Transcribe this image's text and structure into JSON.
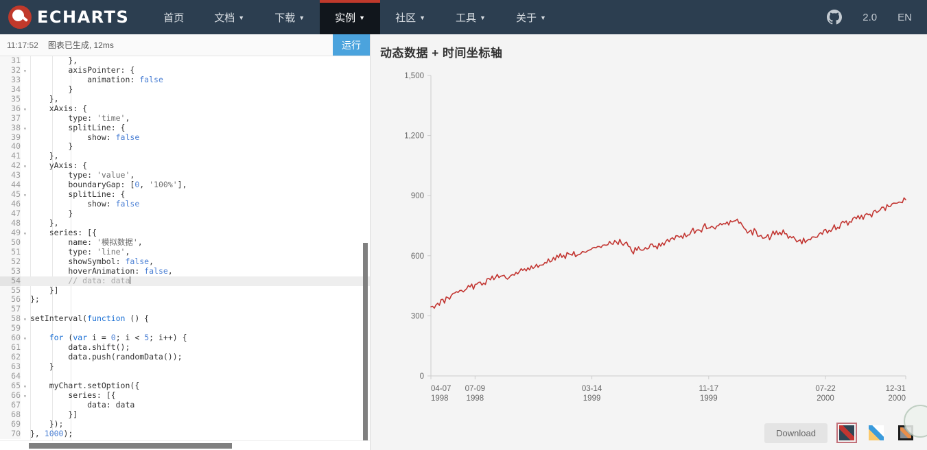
{
  "navbar": {
    "brand": "ECHARTS",
    "logo_icon": "echarts-logo-icon",
    "items": [
      {
        "label": "首页",
        "has_caret": false,
        "active": false
      },
      {
        "label": "文档",
        "has_caret": true,
        "active": false
      },
      {
        "label": "下载",
        "has_caret": true,
        "active": false
      },
      {
        "label": "实例",
        "has_caret": true,
        "active": true
      },
      {
        "label": "社区",
        "has_caret": true,
        "active": false
      },
      {
        "label": "工具",
        "has_caret": true,
        "active": false
      },
      {
        "label": "关于",
        "has_caret": true,
        "active": false
      }
    ],
    "github_icon": "github-icon",
    "version": "2.0",
    "language": "EN",
    "caret_glyph": "▼",
    "bg_color": "#2c3e50",
    "active_bg_color": "#11161c",
    "accent_color": "#c0392b"
  },
  "editor": {
    "status_time": "11:17:52",
    "status_message": "图表已生成, 12ms",
    "run_label": "运行",
    "run_color": "#4ba3dd",
    "active_line": 54,
    "lines": [
      {
        "n": 31,
        "fold": false,
        "tokens": [
          {
            "t": "        },",
            "c": "src"
          }
        ]
      },
      {
        "n": 32,
        "fold": true,
        "tokens": [
          {
            "t": "        axisPointer: {",
            "c": "src"
          }
        ]
      },
      {
        "n": 33,
        "fold": false,
        "tokens": [
          {
            "t": "            animation: ",
            "c": "src"
          },
          {
            "t": "false",
            "c": "bool"
          }
        ]
      },
      {
        "n": 34,
        "fold": false,
        "tokens": [
          {
            "t": "        }",
            "c": "src"
          }
        ]
      },
      {
        "n": 35,
        "fold": false,
        "tokens": [
          {
            "t": "    },",
            "c": "src"
          }
        ]
      },
      {
        "n": 36,
        "fold": true,
        "tokens": [
          {
            "t": "    xAxis: {",
            "c": "src"
          }
        ]
      },
      {
        "n": 37,
        "fold": false,
        "tokens": [
          {
            "t": "        type: ",
            "c": "src"
          },
          {
            "t": "'time'",
            "c": "str"
          },
          {
            "t": ",",
            "c": "src"
          }
        ]
      },
      {
        "n": 38,
        "fold": true,
        "tokens": [
          {
            "t": "        splitLine: {",
            "c": "src"
          }
        ]
      },
      {
        "n": 39,
        "fold": false,
        "tokens": [
          {
            "t": "            show: ",
            "c": "src"
          },
          {
            "t": "false",
            "c": "bool"
          }
        ]
      },
      {
        "n": 40,
        "fold": false,
        "tokens": [
          {
            "t": "        }",
            "c": "src"
          }
        ]
      },
      {
        "n": 41,
        "fold": false,
        "tokens": [
          {
            "t": "    },",
            "c": "src"
          }
        ]
      },
      {
        "n": 42,
        "fold": true,
        "tokens": [
          {
            "t": "    yAxis: {",
            "c": "src"
          }
        ]
      },
      {
        "n": 43,
        "fold": false,
        "tokens": [
          {
            "t": "        type: ",
            "c": "src"
          },
          {
            "t": "'value'",
            "c": "str"
          },
          {
            "t": ",",
            "c": "src"
          }
        ]
      },
      {
        "n": 44,
        "fold": false,
        "tokens": [
          {
            "t": "        boundaryGap: [",
            "c": "src"
          },
          {
            "t": "0",
            "c": "num"
          },
          {
            "t": ", ",
            "c": "src"
          },
          {
            "t": "'100%'",
            "c": "str"
          },
          {
            "t": "],",
            "c": "src"
          }
        ]
      },
      {
        "n": 45,
        "fold": true,
        "tokens": [
          {
            "t": "        splitLine: {",
            "c": "src"
          }
        ]
      },
      {
        "n": 46,
        "fold": false,
        "tokens": [
          {
            "t": "            show: ",
            "c": "src"
          },
          {
            "t": "false",
            "c": "bool"
          }
        ]
      },
      {
        "n": 47,
        "fold": false,
        "tokens": [
          {
            "t": "        }",
            "c": "src"
          }
        ]
      },
      {
        "n": 48,
        "fold": false,
        "tokens": [
          {
            "t": "    },",
            "c": "src"
          }
        ]
      },
      {
        "n": 49,
        "fold": true,
        "tokens": [
          {
            "t": "    series: [{",
            "c": "src"
          }
        ]
      },
      {
        "n": 50,
        "fold": false,
        "tokens": [
          {
            "t": "        name: ",
            "c": "src"
          },
          {
            "t": "'模拟数据'",
            "c": "str"
          },
          {
            "t": ",",
            "c": "src"
          }
        ]
      },
      {
        "n": 51,
        "fold": false,
        "tokens": [
          {
            "t": "        type: ",
            "c": "src"
          },
          {
            "t": "'line'",
            "c": "str"
          },
          {
            "t": ",",
            "c": "src"
          }
        ]
      },
      {
        "n": 52,
        "fold": false,
        "tokens": [
          {
            "t": "        showSymbol: ",
            "c": "src"
          },
          {
            "t": "false",
            "c": "bool"
          },
          {
            "t": ",",
            "c": "src"
          }
        ]
      },
      {
        "n": 53,
        "fold": false,
        "tokens": [
          {
            "t": "        hoverAnimation: ",
            "c": "src"
          },
          {
            "t": "false",
            "c": "bool"
          },
          {
            "t": ",",
            "c": "src"
          }
        ]
      },
      {
        "n": 54,
        "fold": false,
        "tokens": [
          {
            "t": "        // data: data",
            "c": "cmt"
          }
        ],
        "caret": true
      },
      {
        "n": 55,
        "fold": false,
        "tokens": [
          {
            "t": "    }]",
            "c": "src"
          }
        ]
      },
      {
        "n": 56,
        "fold": false,
        "tokens": [
          {
            "t": "};",
            "c": "src"
          }
        ]
      },
      {
        "n": 57,
        "fold": false,
        "tokens": [
          {
            "t": "",
            "c": "src"
          }
        ]
      },
      {
        "n": 58,
        "fold": true,
        "tokens": [
          {
            "t": "setInterval(",
            "c": "src"
          },
          {
            "t": "function",
            "c": "kw"
          },
          {
            "t": " () {",
            "c": "src"
          }
        ]
      },
      {
        "n": 59,
        "fold": false,
        "tokens": [
          {
            "t": "",
            "c": "src"
          }
        ]
      },
      {
        "n": 60,
        "fold": true,
        "tokens": [
          {
            "t": "    ",
            "c": "src"
          },
          {
            "t": "for",
            "c": "kw"
          },
          {
            "t": " (",
            "c": "src"
          },
          {
            "t": "var",
            "c": "kw"
          },
          {
            "t": " i = ",
            "c": "src"
          },
          {
            "t": "0",
            "c": "num"
          },
          {
            "t": "; i < ",
            "c": "src"
          },
          {
            "t": "5",
            "c": "num"
          },
          {
            "t": "; i++) {",
            "c": "src"
          }
        ]
      },
      {
        "n": 61,
        "fold": false,
        "tokens": [
          {
            "t": "        data.shift();",
            "c": "src"
          }
        ]
      },
      {
        "n": 62,
        "fold": false,
        "tokens": [
          {
            "t": "        data.push(randomData());",
            "c": "src"
          }
        ]
      },
      {
        "n": 63,
        "fold": false,
        "tokens": [
          {
            "t": "    }",
            "c": "src"
          }
        ]
      },
      {
        "n": 64,
        "fold": false,
        "tokens": [
          {
            "t": "",
            "c": "src"
          }
        ]
      },
      {
        "n": 65,
        "fold": true,
        "tokens": [
          {
            "t": "    myChart.setOption({",
            "c": "src"
          }
        ]
      },
      {
        "n": 66,
        "fold": true,
        "tokens": [
          {
            "t": "        series: [{",
            "c": "src"
          }
        ]
      },
      {
        "n": 67,
        "fold": false,
        "tokens": [
          {
            "t": "            data: data",
            "c": "src"
          }
        ]
      },
      {
        "n": 68,
        "fold": false,
        "tokens": [
          {
            "t": "        }]",
            "c": "src"
          }
        ]
      },
      {
        "n": 69,
        "fold": false,
        "tokens": [
          {
            "t": "    });",
            "c": "src"
          }
        ]
      },
      {
        "n": 70,
        "fold": false,
        "tokens": [
          {
            "t": "}, ",
            "c": "src"
          },
          {
            "t": "1000",
            "c": "num"
          },
          {
            "t": ");",
            "c": "src"
          }
        ]
      }
    ],
    "fold_glyph": "▾"
  },
  "chart_panel": {
    "title": "动态数据 + 时间坐标轴",
    "download_label": "Download",
    "themes": [
      {
        "name": "theme-dark",
        "selected": true
      },
      {
        "name": "theme-light",
        "selected": false
      },
      {
        "name": "theme-black",
        "selected": false
      }
    ]
  },
  "chart_data": {
    "type": "line",
    "title": "动态数据 + 时间坐标轴",
    "xlabel": "",
    "ylabel": "",
    "series_name": "模拟数据",
    "line_color": "#c23531",
    "grid": false,
    "show_symbol": false,
    "legend": null,
    "ylim": [
      0,
      1500
    ],
    "y_ticks": [
      "0",
      "300",
      "600",
      "900",
      "1,200",
      "1,500"
    ],
    "y_tick_values": [
      0,
      300,
      600,
      900,
      1200,
      1500
    ],
    "x_ticks": [
      {
        "date": "04-07",
        "year": "1998"
      },
      {
        "date": "07-09",
        "year": "1998"
      },
      {
        "date": "03-14",
        "year": "1999"
      },
      {
        "date": "11-17",
        "year": "1999"
      },
      {
        "date": "07-22",
        "year": "2000"
      },
      {
        "date": "12-31",
        "year": "2000"
      }
    ],
    "x_tick_frac": [
      0.0,
      0.093,
      0.339,
      0.585,
      0.831,
      1.0
    ],
    "values": [
      352,
      346,
      340,
      349,
      362,
      358,
      372,
      380,
      374,
      386,
      398,
      392,
      404,
      414,
      406,
      418,
      412,
      424,
      434,
      428,
      420,
      432,
      444,
      438,
      450,
      442,
      456,
      448,
      460,
      470,
      462,
      474,
      466,
      478,
      488,
      480,
      492,
      484,
      496,
      506,
      498,
      490,
      500,
      492,
      484,
      494,
      486,
      498,
      508,
      500,
      512,
      504,
      516,
      526,
      518,
      530,
      522,
      534,
      528,
      540,
      532,
      544,
      556,
      548,
      560,
      552,
      564,
      574,
      566,
      578,
      570,
      582,
      592,
      584,
      596,
      588,
      600,
      592,
      604,
      596,
      608,
      618,
      610,
      602,
      614,
      606,
      598,
      610,
      620,
      612,
      624,
      616,
      628,
      638,
      630,
      642,
      634,
      646,
      638,
      650,
      642,
      654,
      646,
      658,
      650,
      662,
      654,
      666,
      676,
      668,
      660,
      672,
      664,
      656,
      668,
      660,
      650,
      640,
      628,
      618,
      630,
      622,
      634,
      626,
      638,
      630,
      642,
      634,
      646,
      656,
      648,
      640,
      652,
      644,
      656,
      648,
      660,
      652,
      664,
      674,
      666,
      678,
      688,
      680,
      692,
      702,
      694,
      706,
      698,
      710,
      702,
      714,
      706,
      718,
      728,
      720,
      732,
      724,
      736,
      728,
      740,
      750,
      742,
      734,
      746,
      738,
      750,
      742,
      754,
      746,
      758,
      750,
      762,
      754,
      766,
      758,
      770,
      762,
      774,
      766,
      778,
      770,
      760,
      750,
      740,
      730,
      720,
      712,
      722,
      714,
      726,
      718,
      708,
      700,
      692,
      684,
      694,
      686,
      698,
      690,
      702,
      712,
      704,
      716,
      708,
      720,
      712,
      724,
      716,
      706,
      696,
      688,
      698,
      690,
      680,
      672,
      664,
      674,
      666,
      678,
      670,
      682,
      674,
      686,
      696,
      688,
      700,
      692,
      704,
      714,
      706,
      718,
      728,
      720,
      732,
      724,
      736,
      746,
      738,
      750,
      742,
      754,
      764,
      756,
      768,
      760,
      772,
      764,
      776,
      786,
      778,
      790,
      782,
      794,
      786,
      798,
      808,
      800,
      812,
      804,
      816,
      826,
      818,
      830,
      822,
      834,
      844,
      836,
      848,
      840,
      852,
      862,
      854,
      866,
      858,
      870,
      862,
      874,
      884,
      876
    ],
    "x_count": 280
  }
}
